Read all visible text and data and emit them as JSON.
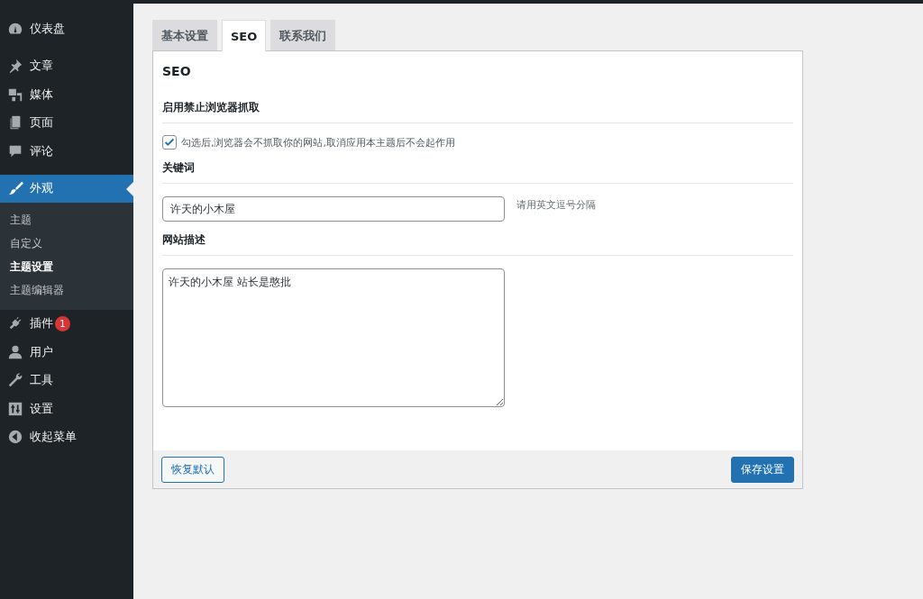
{
  "sidebar": {
    "groups": [
      [
        {
          "label": "仪表盘",
          "kind": "gauge",
          "selected": false
        }
      ],
      [
        {
          "label": "文章",
          "kind": "pin",
          "selected": false
        },
        {
          "label": "媒体",
          "kind": "media",
          "selected": false
        },
        {
          "label": "页面",
          "kind": "pages",
          "selected": false
        },
        {
          "label": "评论",
          "kind": "comment",
          "selected": false
        }
      ],
      [
        {
          "label": "外观",
          "kind": "brush",
          "selected": true,
          "children": [
            {
              "label": "主题",
              "selected": false
            },
            {
              "label": "自定义",
              "selected": false
            },
            {
              "label": "主题设置",
              "selected": true
            },
            {
              "label": "主题编辑器",
              "selected": false
            }
          ]
        },
        {
          "label": "插件",
          "kind": "plug",
          "selected": false,
          "badge": "1"
        },
        {
          "label": "用户",
          "kind": "user",
          "selected": false
        },
        {
          "label": "工具",
          "kind": "wrench",
          "selected": false
        },
        {
          "label": "设置",
          "kind": "sliders",
          "selected": false
        },
        {
          "label": "收起菜单",
          "kind": "collapse",
          "selected": false
        }
      ]
    ]
  },
  "tabs": [
    {
      "label": "基本设置",
      "selected": false
    },
    {
      "label": "SEO",
      "selected": true
    },
    {
      "label": "联系我们",
      "selected": false
    }
  ],
  "panel": {
    "title": "SEO",
    "sections": [
      {
        "kind": "checkbox",
        "heading": "启用禁止浏览器抓取",
        "label": "勾选后,浏览器会不抓取你的网站,取消应用本主题后不会起作用",
        "checked": true
      },
      {
        "kind": "input",
        "heading": "关键词",
        "value": "许天的小木屋",
        "hint": "请用英文逗号分隔"
      },
      {
        "kind": "textarea",
        "heading": "网站描述",
        "value": "许天的小木屋 站长是憨批"
      }
    ],
    "buttons": [
      {
        "label": "恢复默认",
        "kind": "secondary"
      },
      {
        "label": "保存设置",
        "kind": "primary"
      }
    ]
  }
}
